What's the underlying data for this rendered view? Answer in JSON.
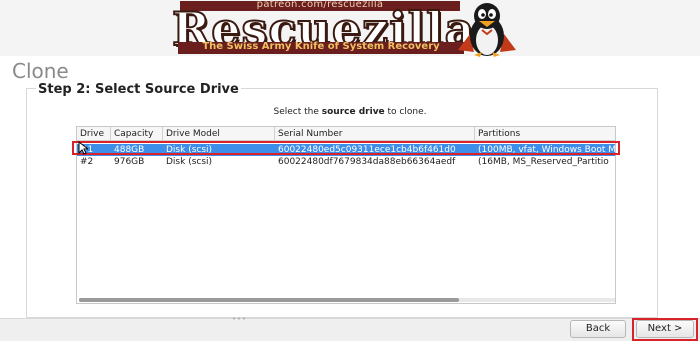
{
  "banner": {
    "url": "patreon.com/rescuezilla",
    "logo": "Rescuezilla",
    "tagline": "The Swiss Army Knife of System Recovery"
  },
  "page_title": "Clone",
  "step_title": "Step 2: Select Source Drive",
  "instruction": {
    "prefix": "Select the ",
    "bold": "source drive",
    "suffix": " to clone."
  },
  "table": {
    "columns": [
      "Drive",
      "Capacity",
      "Drive Model",
      "Serial Number",
      "Partitions"
    ],
    "rows": [
      {
        "drive": "#1",
        "capacity": "488GB",
        "model": "Disk (scsi)",
        "serial": "60022480ed5c09311ece1cb4b6f461d0",
        "partitions": "(100MB, vfat, Windows Boot M",
        "selected": true
      },
      {
        "drive": "#2",
        "capacity": "976GB",
        "model": "Disk (scsi)",
        "serial": "60022480df7679834da88eb66364aedf",
        "partitions": "(16MB, MS_Reserved_Partitio",
        "selected": false
      }
    ]
  },
  "footer": {
    "back_label": "Back",
    "next_label": "Next >"
  },
  "colors": {
    "selection": "#3d8ee8",
    "highlight_outline": "#d8232a"
  },
  "icons": [
    "penguin-mascot-icon",
    "mouse-cursor-icon"
  ]
}
